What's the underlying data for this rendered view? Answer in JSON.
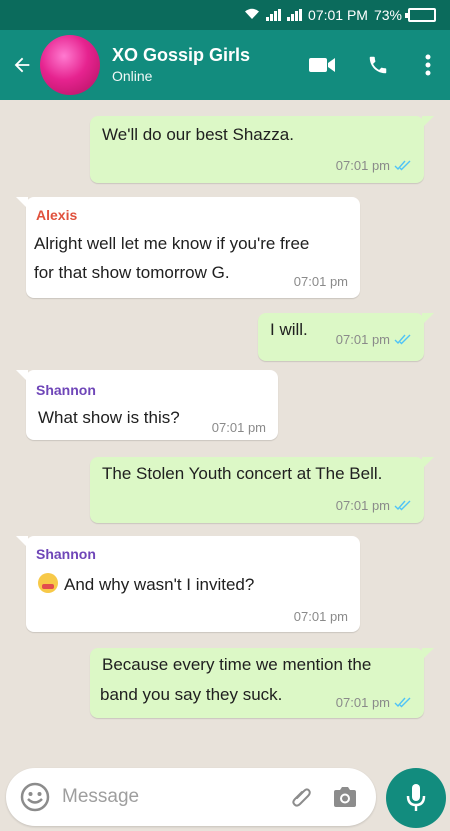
{
  "status_bar": {
    "time": "07:01 PM",
    "battery": "73%"
  },
  "header": {
    "title": "XO Gossip Girls",
    "subtitle": "Online",
    "icons": [
      "back-arrow-icon",
      "video-call-icon",
      "phone-icon",
      "more-vert-icon"
    ]
  },
  "messages": [
    {
      "direction": "out",
      "text": "We'll do our best Shazza.",
      "time": "07:01 pm",
      "status": "read"
    },
    {
      "direction": "in",
      "sender": "Alexis",
      "sender_color": "#e0513d",
      "lines": [
        " Alright well let me know if you're free",
        "for that show tomorrow G."
      ],
      "time": "07:01 pm"
    },
    {
      "direction": "out",
      "text": "I will.",
      "time": "07:01 pm",
      "status": "read"
    },
    {
      "direction": "in",
      "sender": "Shannon",
      "sender_color": "#6f46b8",
      "text": "What show is this?",
      "time": "07:01 pm"
    },
    {
      "direction": "out",
      "text": "The Stolen Youth concert at The Bell.",
      "time": "07:01 pm",
      "status": "read"
    },
    {
      "direction": "in",
      "sender": "Shannon",
      "sender_color": "#6f46b8",
      "text": "And why wasn't I invited?",
      "emoji": "blush-emoji",
      "time": "07:01 pm"
    },
    {
      "direction": "out",
      "lines": [
        "Because every time we mention the",
        "band you say they suck."
      ],
      "time": "07:01 pm",
      "status": "read"
    }
  ],
  "composer": {
    "placeholder": "Message"
  },
  "colors": {
    "header": "#128c7e",
    "status_bar": "#0b6b5c",
    "outgoing_bubble": "#dcf8c6",
    "incoming_bubble": "#ffffff",
    "read_ticks": "#4fc3f7"
  }
}
